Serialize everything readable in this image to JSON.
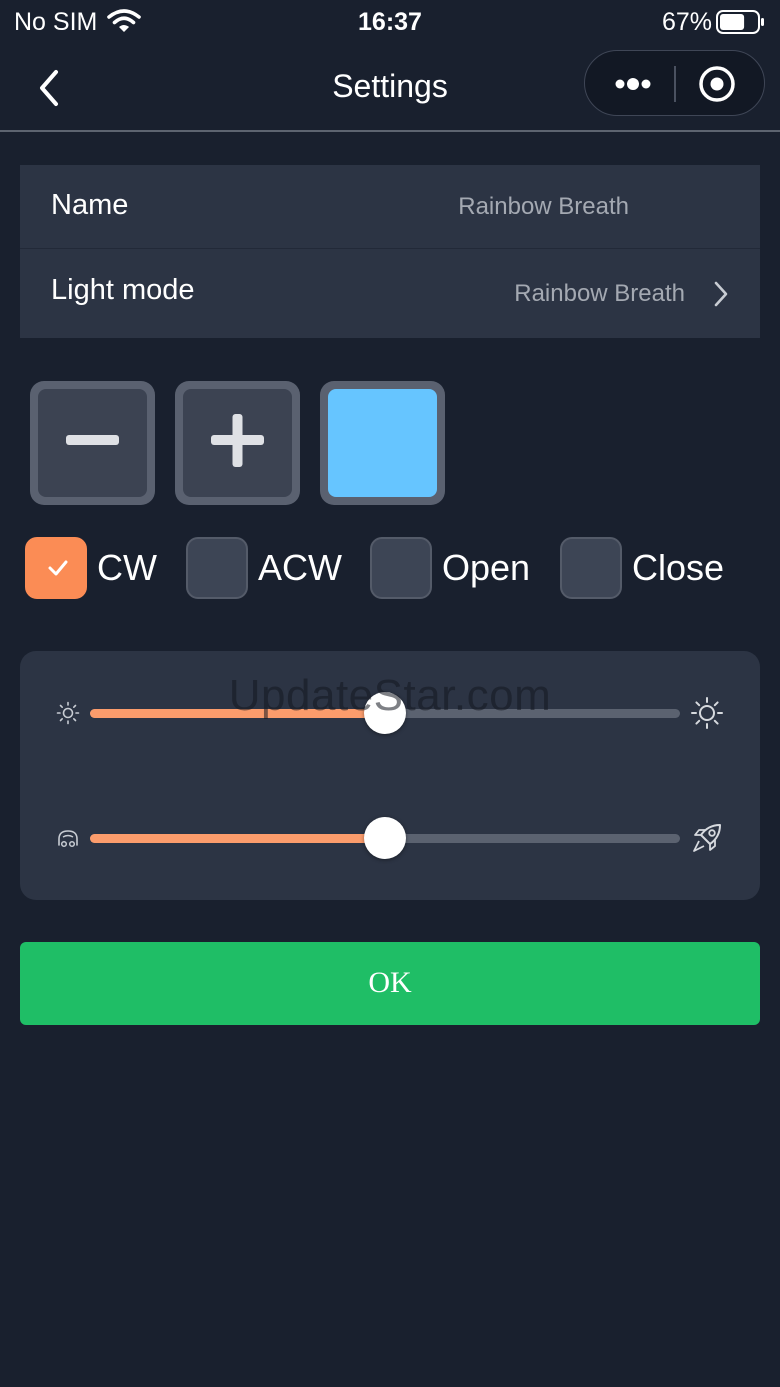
{
  "status_bar": {
    "carrier": "No SIM",
    "time": "16:37",
    "battery_percent": "67%",
    "battery_level": 0.67
  },
  "nav": {
    "title": "Settings",
    "back_icon": "chevron-left-icon",
    "more_icon": "more-dots-icon",
    "close_icon": "target-icon"
  },
  "settings": {
    "name_label": "Name",
    "name_value": "Rainbow Breath",
    "mode_label": "Light mode",
    "mode_value": "Rainbow Breath"
  },
  "color_controls": {
    "minus_icon": "minus-icon",
    "plus_icon": "plus-icon",
    "selected_color": "#66c5ff"
  },
  "options": [
    {
      "label": "CW",
      "checked": true
    },
    {
      "label": "ACW",
      "checked": false
    },
    {
      "label": "Open",
      "checked": false
    },
    {
      "label": "Close",
      "checked": false
    }
  ],
  "sliders": {
    "watermark": "UpdateStar.com",
    "brightness": {
      "value": 0.5,
      "left_icon": "sun-small-icon",
      "right_icon": "sun-large-icon"
    },
    "speed": {
      "value": 0.5,
      "left_icon": "snail-icon",
      "right_icon": "rocket-icon"
    }
  },
  "ok_button": {
    "label": "OK"
  },
  "colors": {
    "background": "#19202e",
    "card": "#2c3444",
    "accent": "#fb8c55",
    "ok_green": "#1fbe66"
  }
}
